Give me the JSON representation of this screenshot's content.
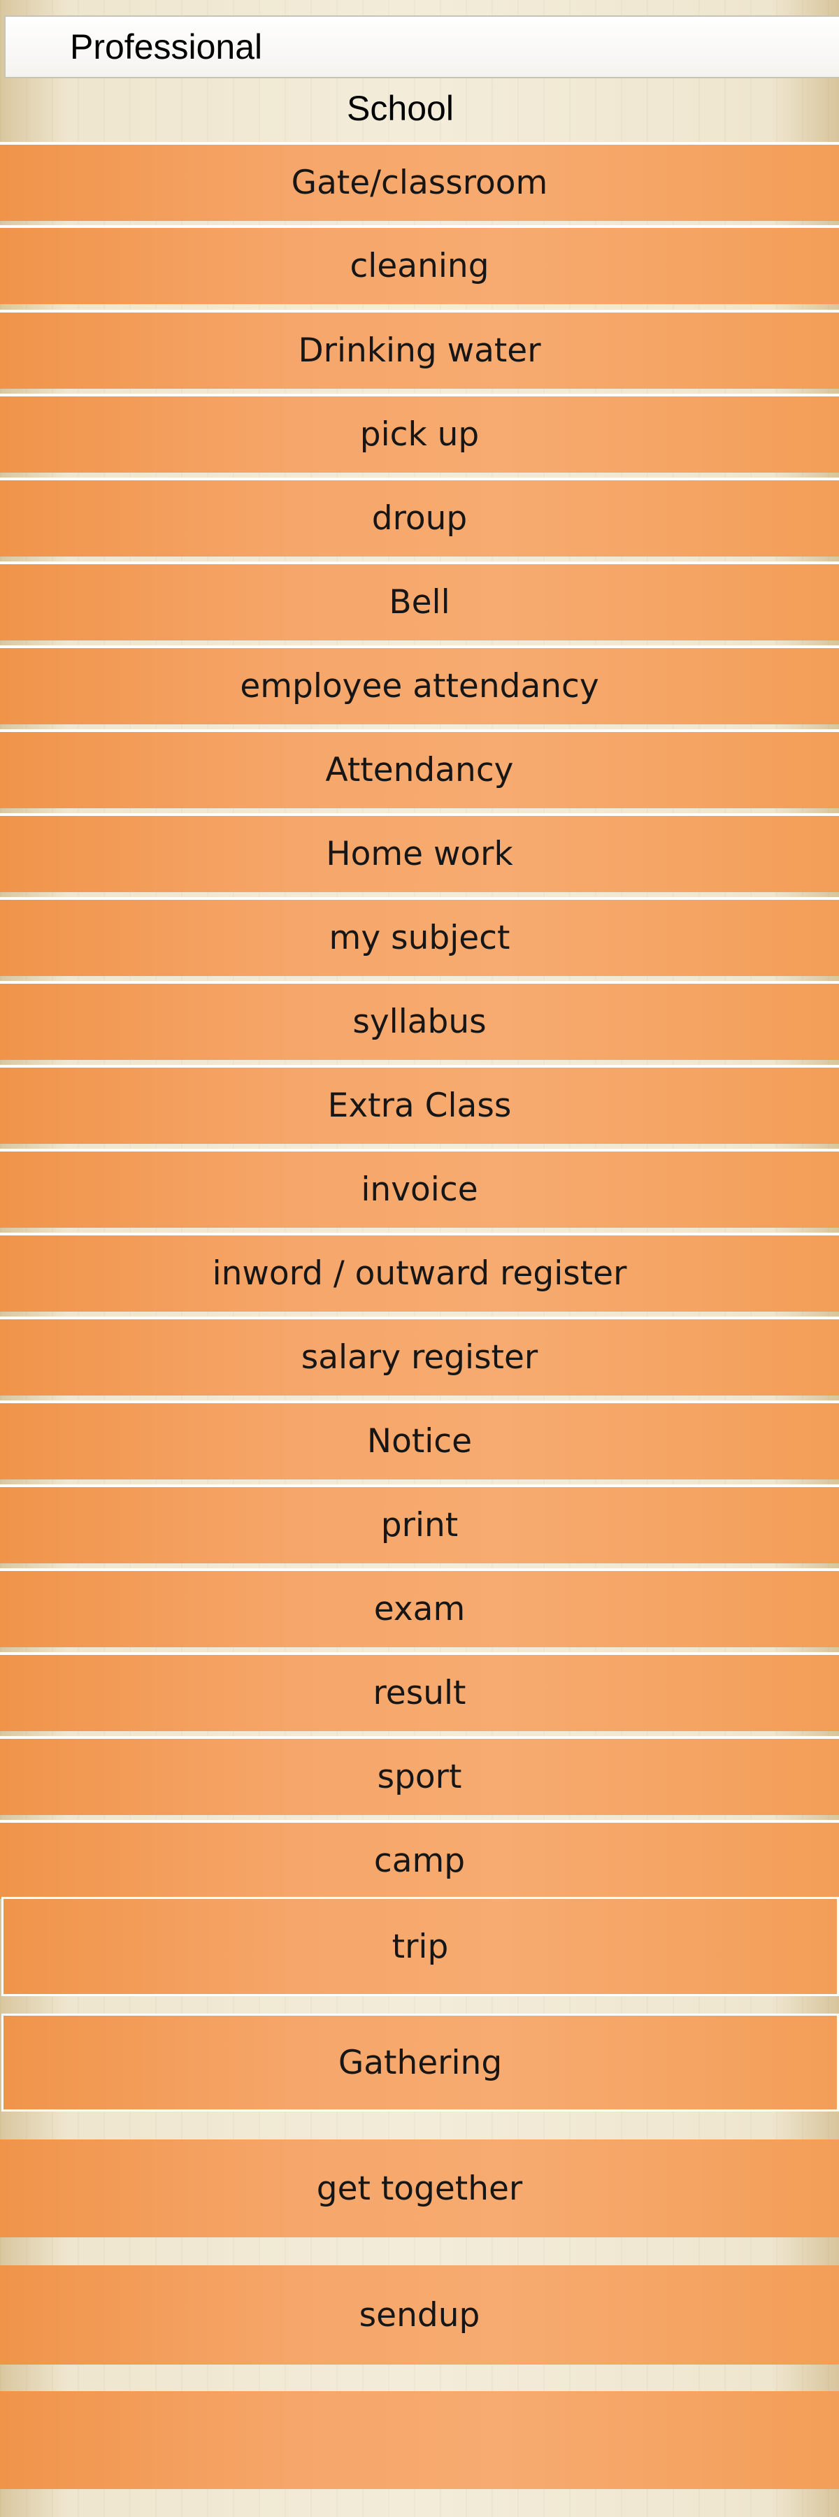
{
  "header": {
    "title": "Professional"
  },
  "section": {
    "title": "School"
  },
  "menu": {
    "items": [
      {
        "label": "Gate/classroom"
      },
      {
        "label": "cleaning"
      },
      {
        "label": "Drinking water"
      },
      {
        "label": "pick up"
      },
      {
        "label": "droup"
      },
      {
        "label": "Bell"
      },
      {
        "label": "employee attendancy"
      },
      {
        "label": "Attendancy"
      },
      {
        "label": "Home work"
      },
      {
        "label": "my subject"
      },
      {
        "label": "syllabus"
      },
      {
        "label": "Extra Class"
      },
      {
        "label": "invoice"
      },
      {
        "label": "inword / outward register"
      },
      {
        "label": "salary register"
      },
      {
        "label": "Notice"
      },
      {
        "label": "print"
      },
      {
        "label": "exam"
      },
      {
        "label": "result"
      },
      {
        "label": "sport"
      },
      {
        "label": "camp"
      },
      {
        "label": "trip"
      },
      {
        "label": "Gathering"
      },
      {
        "label": "get together"
      },
      {
        "label": "sendup"
      },
      {
        "label": ""
      }
    ]
  },
  "colors": {
    "item_bg": "#f6a66a",
    "page_bg": "#f3ecd9",
    "divider": "#ffffff"
  }
}
